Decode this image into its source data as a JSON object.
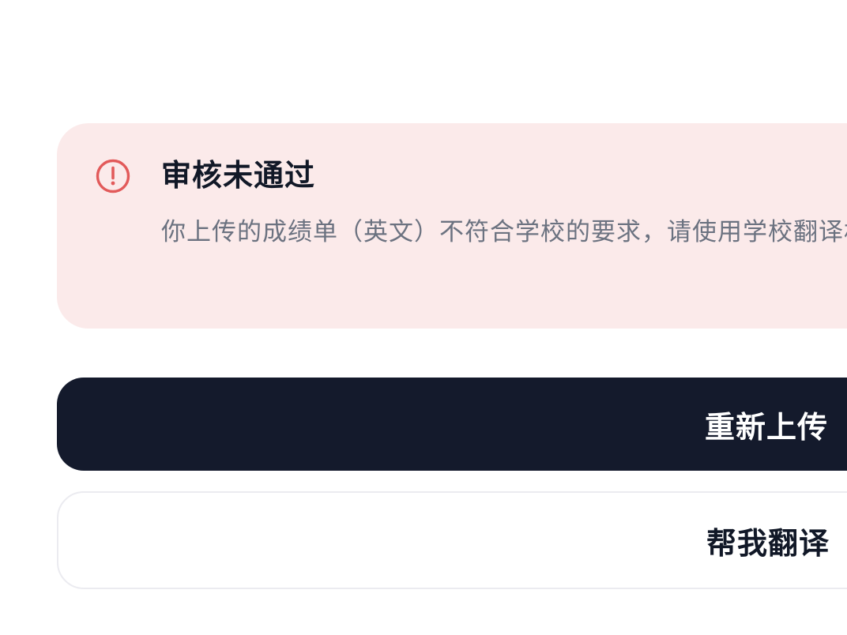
{
  "alert": {
    "icon": "exclamation-circle-icon",
    "icon_color": "#e25a5a",
    "background_color": "#fbeaea",
    "title": "审核未通过",
    "message": "你上传的成绩单（英文）不符合学校的要求，请使用学校翻译机构翻译件。"
  },
  "actions": {
    "reupload_label": "重新上传",
    "translate_label": "帮我翻译",
    "primary_color": "#141a2c"
  }
}
